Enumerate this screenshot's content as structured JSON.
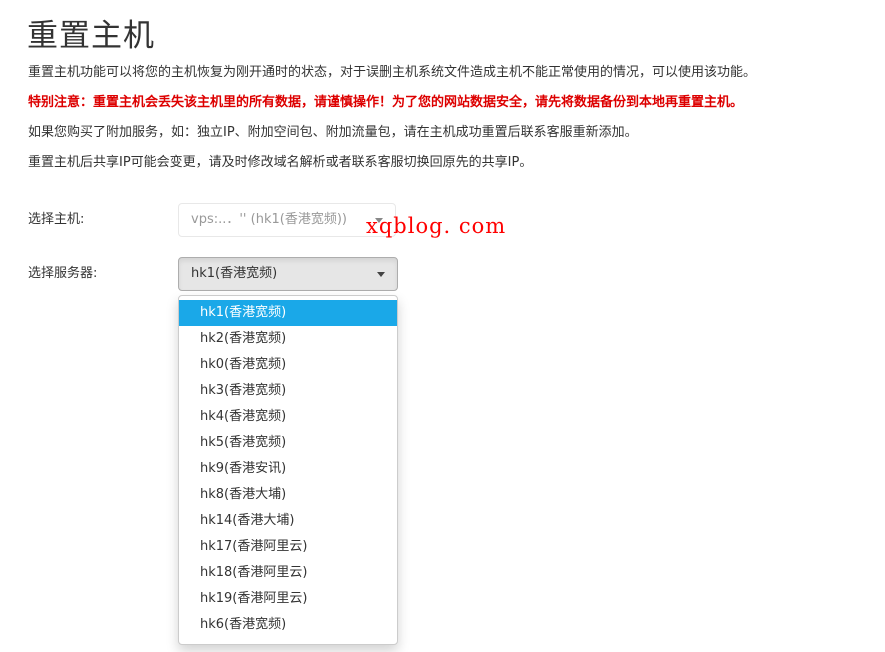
{
  "header": {
    "title": "重置主机"
  },
  "notices": {
    "line1": "重置主机功能可以将您的主机恢复为刚开通时的状态，对于误删主机系统文件造成主机不能正常使用的情况，可以使用该功能。",
    "warning": "特别注意：重置主机会丢失该主机里的所有数据，请谨慎操作！为了您的网站数据安全，请先将数据备份到本地再重置主机。",
    "line3": "如果您购买了附加服务，如：独立IP、附加空间包、附加流量包，请在主机成功重置后联系客服重新添加。",
    "line4": "重置主机后共享IP可能会变更，请及时修改域名解析或者联系客服切换回原先的共享IP。"
  },
  "form": {
    "host_label": "选择主机:",
    "host_value": "vps:..．'' (hk1(香港宽频))",
    "server_label": "选择服务器:",
    "server_value": "hk1(香港宽频)"
  },
  "watermark": "xqblog. com",
  "server_options": [
    "hk1(香港宽频)",
    "hk2(香港宽频)",
    "hk0(香港宽频)",
    "hk3(香港宽频)",
    "hk4(香港宽频)",
    "hk5(香港宽频)",
    "hk9(香港安讯)",
    "hk8(香港大埔)",
    "hk14(香港大埔)",
    "hk17(香港阿里云)",
    "hk18(香港阿里云)",
    "hk19(香港阿里云)",
    "hk6(香港宽频)"
  ],
  "selected_index": 0,
  "colors": {
    "warning": "#dd0000",
    "highlight": "#1aa8e8",
    "watermark": "#ff0000"
  }
}
